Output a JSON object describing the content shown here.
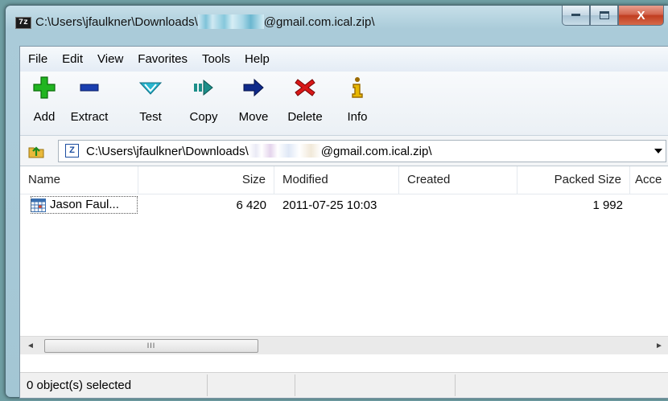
{
  "window": {
    "app_logo": "7z",
    "title_prefix": "C:\\Users\\jfaulkner\\Downloads\\",
    "title_suffix": "@gmail.com.ical.zip\\",
    "minimize_icon": "minimize-icon",
    "maximize_icon": "maximize-icon",
    "close_label": "X"
  },
  "menu": [
    "File",
    "Edit",
    "View",
    "Favorites",
    "Tools",
    "Help"
  ],
  "toolbar": {
    "add": "Add",
    "extract": "Extract",
    "test": "Test",
    "copy": "Copy",
    "move": "Move",
    "delete": "Delete",
    "info": "Info"
  },
  "address": {
    "path_prefix": "C:\\Users\\jfaulkner\\Downloads\\",
    "path_suffix": "@gmail.com.ical.zip\\",
    "icon_label": "Z"
  },
  "columns": {
    "name": "Name",
    "size": "Size",
    "modified": "Modified",
    "created": "Created",
    "packed_size": "Packed Size",
    "accessed": "Acce"
  },
  "files": [
    {
      "name": "Jason Faul...",
      "size": "6 420",
      "modified": "2011-07-25 10:03",
      "created": "",
      "packed_size": "1 992"
    }
  ],
  "scrollbar": {
    "grip": "III",
    "left_arrow": "◄",
    "right_arrow": "►"
  },
  "status": {
    "text": "0 object(s) selected"
  },
  "colors": {
    "add": "#21b521",
    "extract": "#1a3fb0",
    "test": "#29b6cf",
    "copy": "#1d8f8a",
    "move": "#0f2a8a",
    "delete": "#d81818",
    "info": "#9a6a00"
  }
}
